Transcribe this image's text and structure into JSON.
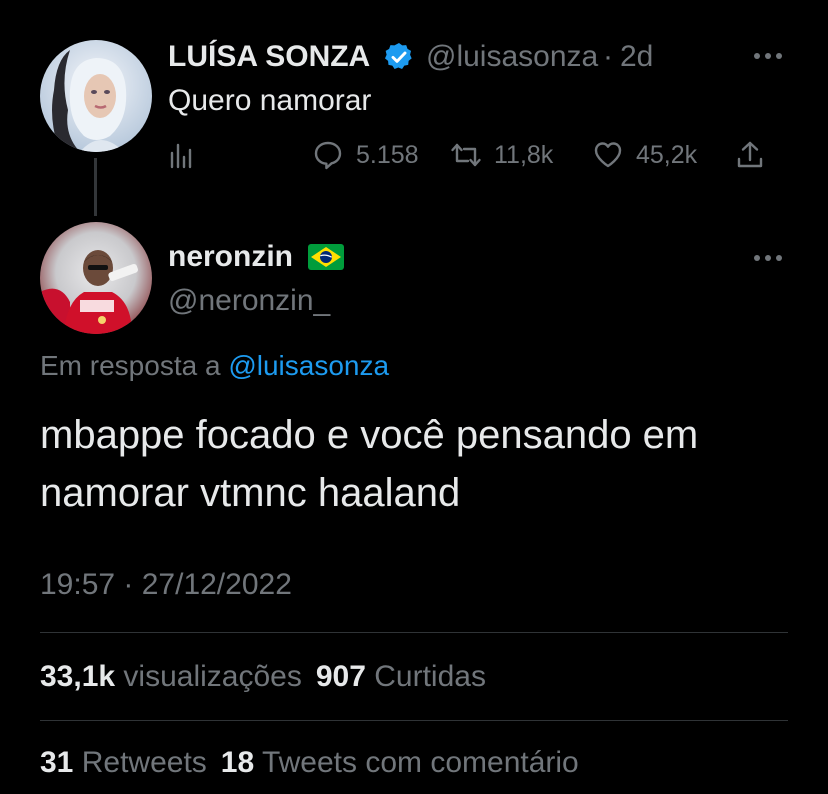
{
  "original_tweet": {
    "display_name": "LUÍSA SONZA",
    "handle": "@luisasonza",
    "separator": "·",
    "time_ago": "2d",
    "text": "Quero namorar",
    "actions": {
      "replies": "5.158",
      "retweets": "11,8k",
      "likes": "45,2k"
    },
    "icons": [
      "verified-badge-icon",
      "views-icon",
      "reply-icon",
      "retweet-icon",
      "like-icon",
      "share-icon",
      "more-icon"
    ]
  },
  "reply_tweet": {
    "display_name": "neronzin",
    "handle": "@neronzin_",
    "reply_prefix": "Em resposta a",
    "reply_mention": "@luisasonza",
    "text": "mbappe focado e você pensando em namorar vtmnc haaland",
    "timestamp": "19:57 · 27/12/2022",
    "stats": {
      "views_count": "33,1k",
      "views_label": "visualizações",
      "likes_count": "907",
      "likes_label": "Curtidas",
      "retweets_count": "31",
      "retweets_label": "Retweets",
      "quotes_count": "18",
      "quotes_label": "Tweets com comentário"
    },
    "icons": [
      "brazil-flag-icon",
      "more-icon"
    ]
  },
  "colors": {
    "background": "#000000",
    "text_primary": "#e7e9ea",
    "text_secondary": "#71767b",
    "accent": "#1d9bf0",
    "divider": "#2f3336"
  }
}
